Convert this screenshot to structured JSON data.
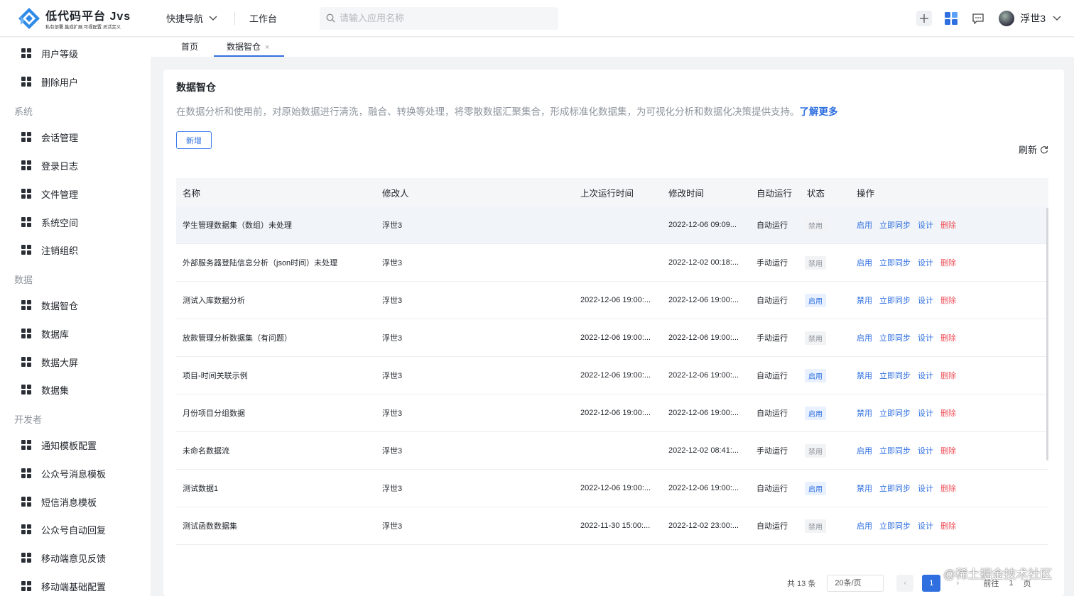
{
  "app": {
    "logo_title": "低代码平台 Jvs",
    "logo_subtitle": "私有部署.集成扩展.可视配置.灵活定义",
    "quick_nav_label": "快捷导航",
    "workbench_label": "工作台",
    "search_placeholder": "请输入应用名称",
    "username": "浮世3"
  },
  "sidebar": {
    "items_top": [
      "用户等级",
      "删除用户"
    ],
    "group_system": "系统",
    "items_system": [
      "会话管理",
      "登录日志",
      "文件管理",
      "系统空间",
      "注销组织"
    ],
    "group_data": "数据",
    "items_data": [
      "数据智仓",
      "数据库",
      "数据大屏",
      "数据集"
    ],
    "group_dev": "开发者",
    "items_dev": [
      "通知模板配置",
      "公众号消息模板",
      "短信消息模板",
      "公众号自动回复",
      "移动端意见反馈",
      "移动端基础配置"
    ]
  },
  "tabs": {
    "home": "首页",
    "current": "数据智仓",
    "close_glyph": "×"
  },
  "page": {
    "title": "数据智仓",
    "description": "在数据分析和使用前，对原始数据进行清洗，融合、转换等处理，将零散数据汇聚集合，形成标准化数据集，为可视化分析和数据化决策提供支持。",
    "learn_more": "了解更多",
    "add_button": "新增",
    "refresh_label": "刷新"
  },
  "table": {
    "columns": [
      "名称",
      "修改人",
      "上次运行时间",
      "修改时间",
      "自动运行",
      "状态",
      "操作"
    ],
    "rows": [
      {
        "name": "学生管理数据集（数组）未处理",
        "modifier": "浮世3",
        "last_run": "",
        "modified": "2022-12-06 09:09...",
        "mode": "自动运行",
        "status": "禁用",
        "status_on": false,
        "action1": "启用"
      },
      {
        "name": "外部服务器登陆信息分析（json时间）未处理",
        "modifier": "浮世3",
        "last_run": "",
        "modified": "2022-12-02 00:18:...",
        "mode": "手动运行",
        "status": "禁用",
        "status_on": false,
        "action1": "启用"
      },
      {
        "name": "测试入库数据分析",
        "modifier": "浮世3",
        "last_run": "2022-12-06 19:00:...",
        "modified": "2022-12-06 19:00:...",
        "mode": "自动运行",
        "status": "启用",
        "status_on": true,
        "action1": "禁用"
      },
      {
        "name": "放款管理分析数据集（有问题）",
        "modifier": "浮世3",
        "last_run": "2022-12-06 19:00:...",
        "modified": "2022-12-06 19:00:...",
        "mode": "手动运行",
        "status": "禁用",
        "status_on": false,
        "action1": "启用"
      },
      {
        "name": "项目-时间关联示例",
        "modifier": "浮世3",
        "last_run": "2022-12-06 19:00:...",
        "modified": "2022-12-06 19:00:...",
        "mode": "自动运行",
        "status": "启用",
        "status_on": true,
        "action1": "禁用"
      },
      {
        "name": "月份项目分组数据",
        "modifier": "浮世3",
        "last_run": "2022-12-06 19:00:...",
        "modified": "2022-12-06 19:00:...",
        "mode": "自动运行",
        "status": "启用",
        "status_on": true,
        "action1": "禁用"
      },
      {
        "name": "未命名数据流",
        "modifier": "浮世3",
        "last_run": "",
        "modified": "2022-12-02 08:41:...",
        "mode": "手动运行",
        "status": "禁用",
        "status_on": false,
        "action1": "启用"
      },
      {
        "name": "测试数据1",
        "modifier": "浮世3",
        "last_run": "2022-12-06 19:00:...",
        "modified": "2022-12-06 19:00:...",
        "mode": "自动运行",
        "status": "启用",
        "status_on": true,
        "action1": "禁用"
      },
      {
        "name": "测试函数数据集",
        "modifier": "浮世3",
        "last_run": "2022-11-30 15:00:...",
        "modified": "2022-12-02 23:00:...",
        "mode": "自动运行",
        "status": "禁用",
        "status_on": false,
        "action1": "启用"
      }
    ],
    "action_sync": "立即同步",
    "action_design": "设计",
    "action_delete": "删除"
  },
  "pager": {
    "total": "共 13 条",
    "page_size": "20条/页",
    "current_page": "1",
    "goto_label": "前往",
    "goto_value": "1",
    "page_suffix": "页"
  },
  "watermark": "@稀土掘金技术社区",
  "colors": {
    "accent": "#2f6fe0",
    "danger": "#f0505a",
    "muted": "#8f959e"
  }
}
